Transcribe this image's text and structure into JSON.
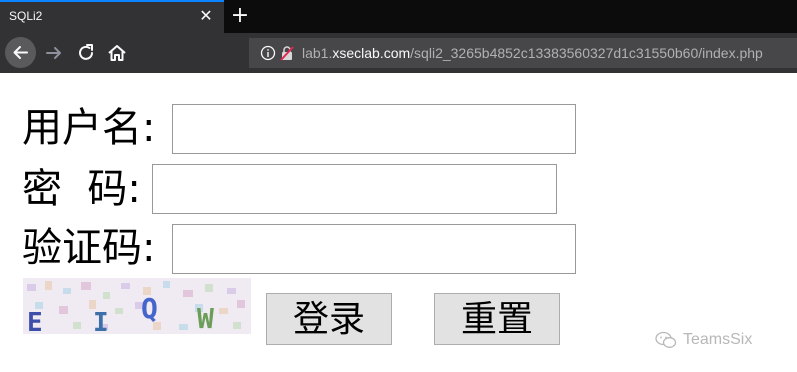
{
  "browser": {
    "tab_title": "SQLi2",
    "url": {
      "prefix": "lab1.",
      "domain": "xseclab.com",
      "path": "/sqli2_3265b4852c13383560327d1c31550b60/index.php"
    }
  },
  "form": {
    "username_label": "用户名:",
    "password_label": "密  码:",
    "captcha_label": "验证码:",
    "username_value": "",
    "password_value": "",
    "captcha_value": "",
    "captcha_chars": [
      "E",
      "I",
      "Q",
      "W"
    ],
    "login_label": "登录",
    "reset_label": "重置"
  },
  "watermark": {
    "text": "TeamsSix"
  }
}
